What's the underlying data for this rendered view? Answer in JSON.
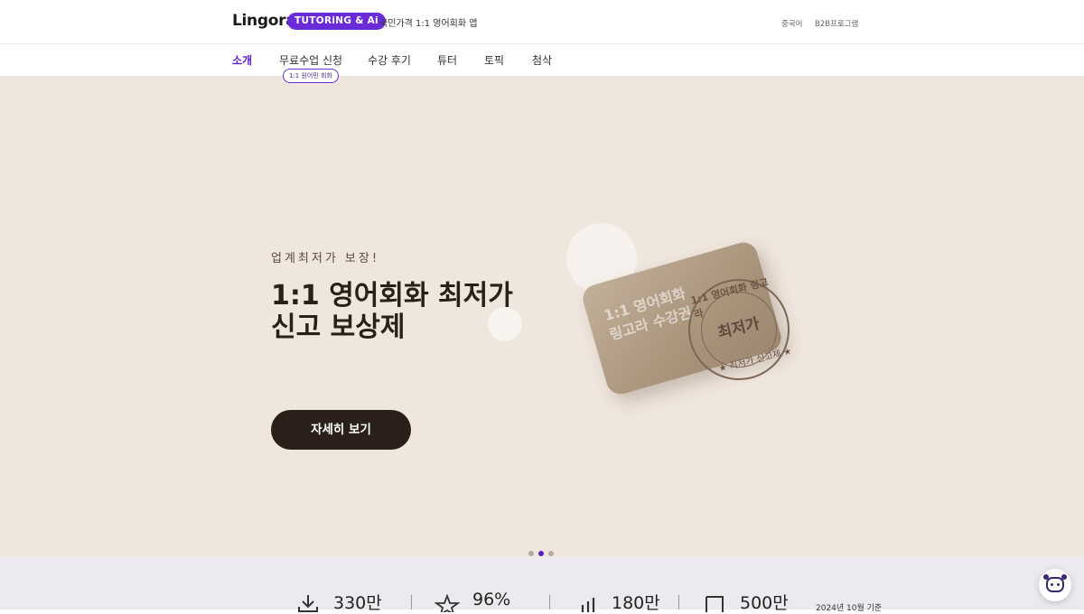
{
  "header": {
    "logo": "Lingora",
    "badge": "TUTORiNG & Ai",
    "tagline": "국민가격 1:1 영어회화 앱",
    "links": [
      "중국어",
      "B2B프로그램"
    ]
  },
  "nav": {
    "items": [
      "소개",
      "무료수업 신청",
      "수강 후기",
      "튜터",
      "토픽",
      "첨삭"
    ],
    "active": "소개",
    "sub_badge": "1:1 원어민 회화"
  },
  "hero": {
    "kicker": "업계최저가 보장!",
    "title": "1:1 영어회화 최저가 신고 보상제",
    "cta": "자세히 보기",
    "card_text": "1:1 영어회화\n링고라 수강권",
    "stamp": {
      "main": "최저가",
      "top": "1:1 영어회화 링고라",
      "bottom": "★ 최저가 신고제 ★"
    },
    "slides": {
      "count": 3,
      "active_index": 1
    },
    "colors": {
      "background": "#efe6dd",
      "cta": "#2b2019",
      "accent": "#5a1fc2"
    }
  },
  "stats": {
    "items": [
      {
        "icon": "download-icon",
        "value": "330만"
      },
      {
        "icon": "star-icon",
        "value": "96%"
      },
      {
        "icon": "chart-icon",
        "value": "180만"
      },
      {
        "icon": "document-icon",
        "value": "500만"
      }
    ],
    "note": "2024년 10월 기준"
  },
  "chat": {
    "icon": "chatbot-face-icon"
  }
}
